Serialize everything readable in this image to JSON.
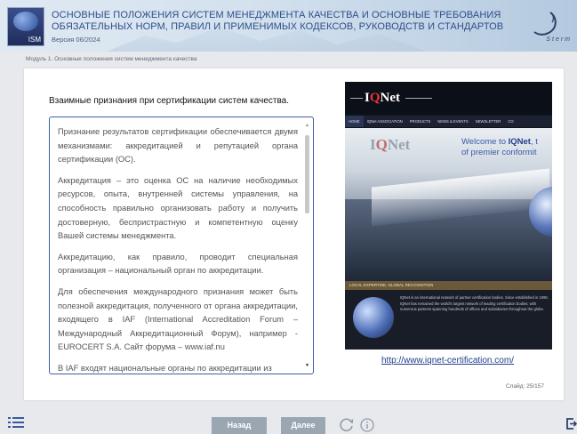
{
  "header": {
    "logo_text": "ISM",
    "title_line1": "ОСНОВНЫЕ ПОЛОЖЕНИЯ СИСТЕМ МЕНЕДЖМЕНТА КАЧЕСТВА И ОСНОВНЫЕ ТРЕБОВАНИЯ",
    "title_line2": "ОБЯЗАТЕЛЬНЫХ НОРМ, ПРАВИЛ И ПРИМЕНИМЫХ КОДЕКСОВ, РУКОВОДСТВ И СТАНДАРТОВ",
    "version": "Версия 06/2024",
    "brand_text": "Sterm"
  },
  "breadcrumb": "Модуль 1. Основные положения систем менеджмента качества",
  "content": {
    "heading": "Взаимные признания при сертификации систем качества.",
    "paragraphs": [
      "Признание результатов сертификации обеспечивается двумя механизмами: аккредитацией и репутацией органа сертификации (ОС).",
      "Аккредитация – это оценка ОС на наличие необходимых ресурсов, опыта, внутренней системы управления, на способность правильно организовать работу и получить достоверную, беспристрастную и компетентную оценку Вашей системы менеджмента.",
      "Аккредитацию, как правило, проводит специальная организация – национальный орган по аккредитации.",
      "Для обеспечения международного признания может быть полезной аккредитация, полученного от органа аккредитации, входящего в IAF (International Accreditation Forum – Международный Аккредитационный Форум), например - EUROCERT S.A. Сайт форума – www.iaf.nu",
      "В IAF входят национальные органы по аккредитации из"
    ]
  },
  "image": {
    "logo_pre": "I",
    "logo_q": "Q",
    "logo_post": "Net",
    "nav": [
      "HOME",
      "IQNet ASSOCIATION",
      "PRODUCTS",
      "NEWS & EVENTS",
      "NEWSLETTER",
      "CO"
    ],
    "welcome_pre": "Welcome to ",
    "welcome_brand": "IQNet",
    "welcome_end": ", t",
    "welcome_line2": "of premier conformit",
    "band": "LOCAL EXPERTISE, GLOBAL RECOGNITION",
    "bottom_text": "IQNet is an international network of partner certification bodies. Since established in 1990, IQNet has remained the world's largest network of leading certification bodies; with numerous partners spanning hundreds of offices and subsidiaries throughout the globe."
  },
  "link": "http://www.iqnet-certification.com/",
  "slide_counter": "Слайд: 25/157",
  "footer": {
    "back_label": "Назад",
    "next_label": "Далее"
  },
  "colors": {
    "title": "#2d4f8a",
    "textbox_border": "#3a5fa4",
    "button": "#9aa6b2",
    "link": "#1f3f8a"
  }
}
